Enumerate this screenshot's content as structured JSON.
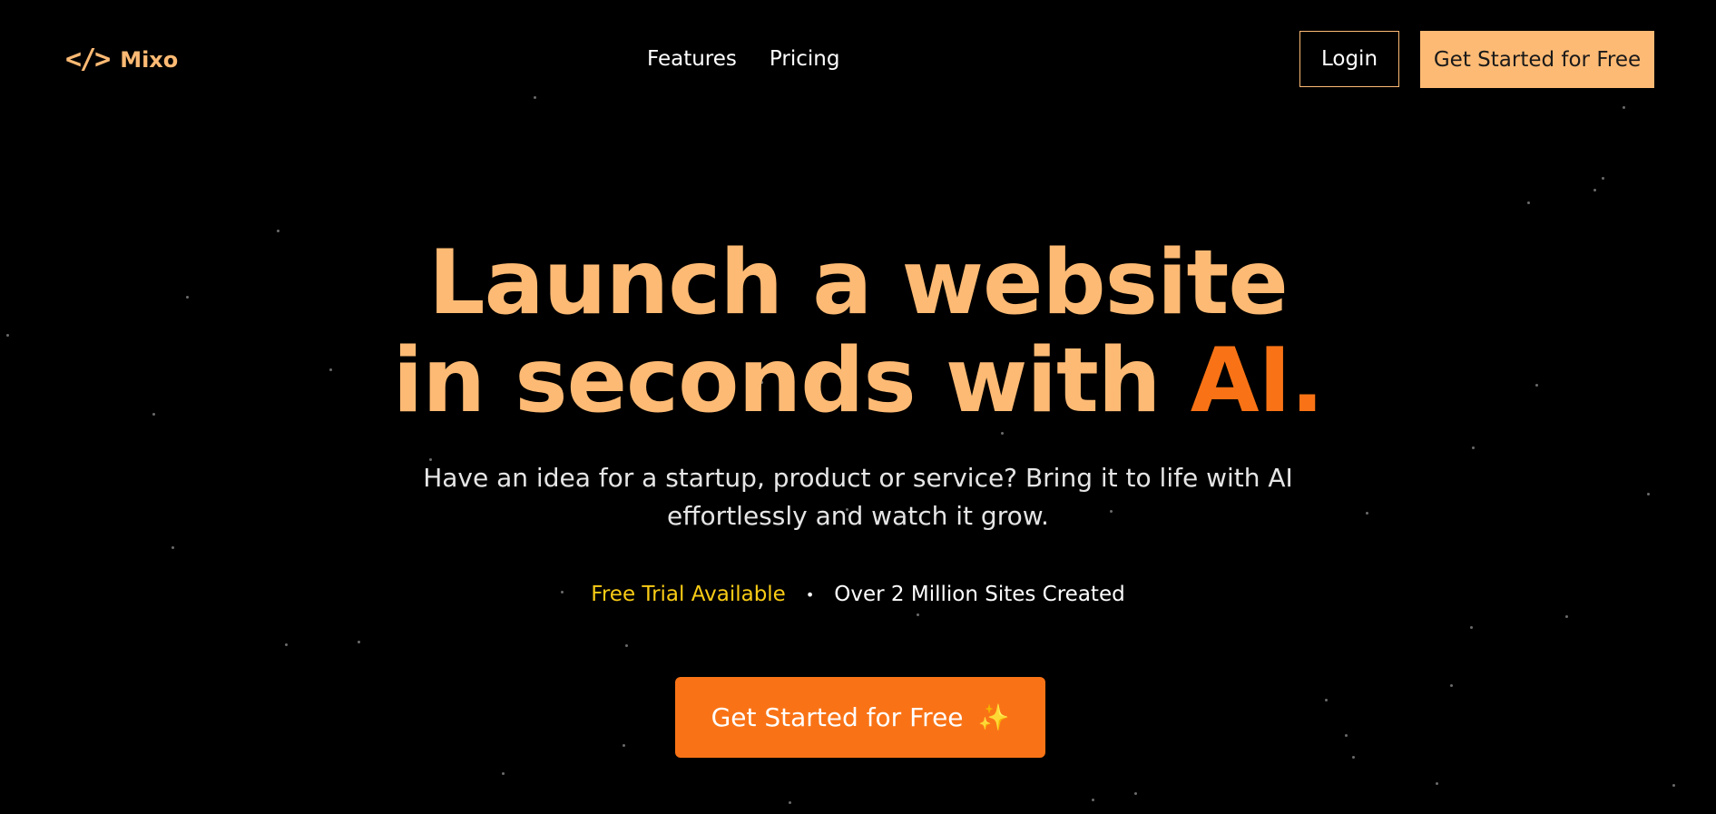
{
  "header": {
    "logo_text": "Mixo",
    "nav": [
      {
        "label": "Features"
      },
      {
        "label": "Pricing"
      }
    ],
    "login_label": "Login",
    "cta_label": "Get Started for Free"
  },
  "hero": {
    "title_line1": "Launch a website",
    "title_line2_prefix": "in seconds with ",
    "title_accent": "AI.",
    "subtitle_line1": "Have an idea for a startup, product or service? Bring it to life with AI",
    "subtitle_line2": "effortlessly and watch it grow.",
    "stat_trial": "Free Trial Available",
    "stat_separator": "•",
    "stat_sites": "Over 2 Million Sites Created",
    "cta_label": "Get Started for Free",
    "cta_icon": "sparkles-icon"
  },
  "colors": {
    "background": "#000000",
    "primary_light": "#fdba74",
    "primary": "#f97316",
    "highlight": "#facc15"
  }
}
